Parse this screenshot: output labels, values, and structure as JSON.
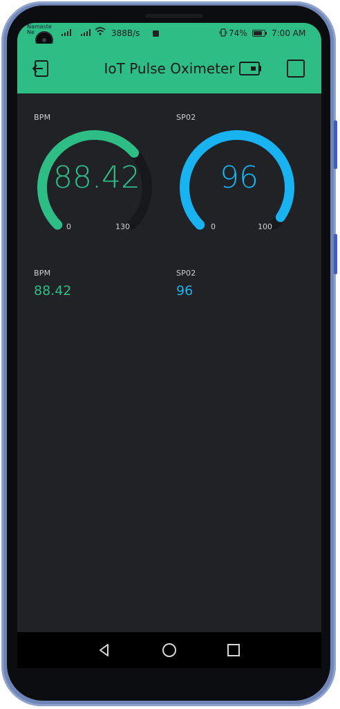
{
  "status_bar": {
    "carrier": "Namaste Ne",
    "speed": "388B/s",
    "battery": "74%",
    "time": "7:00 AM"
  },
  "app_bar": {
    "title": "IoT Pulse Oximeter",
    "icons": [
      "exit-icon",
      "battery-device-icon",
      "square-icon"
    ]
  },
  "gauges": [
    {
      "label": "BPM",
      "value": "88.42",
      "numeric": 88.42,
      "min": "0",
      "max": "130",
      "color": "#2ebd85"
    },
    {
      "label": "SP02",
      "value": "96",
      "numeric": 96,
      "min": "0",
      "max": "100",
      "color": "#18b3f0"
    }
  ],
  "displays": [
    {
      "label": "BPM",
      "value": "88.42",
      "color": "#2ebd85"
    },
    {
      "label": "SP02",
      "value": "96",
      "color": "#18b3f0"
    }
  ],
  "nav_bar": {
    "icons": [
      "back-icon",
      "home-icon",
      "recents-icon"
    ]
  },
  "colors": {
    "accent": "#2ebd85",
    "background": "#212226",
    "spo2": "#18b3f0"
  }
}
